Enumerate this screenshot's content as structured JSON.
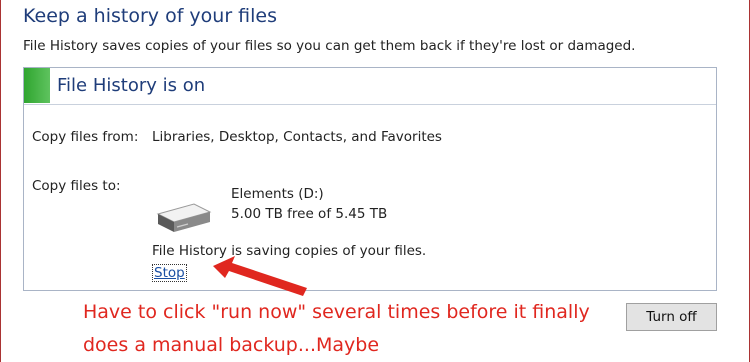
{
  "page": {
    "title": "Keep a history of your files",
    "description": "File History saves copies of your files so you can get them back if they're lost or damaged."
  },
  "status_panel": {
    "status_title": "File History is on",
    "status_color": "#3bab3b",
    "copy_from_label": "Copy files from:",
    "copy_from_value": "Libraries, Desktop, Contacts, and Favorites",
    "copy_to_label": "Copy files to:",
    "drive_icon": "hard-drive-icon",
    "drive_name": "Elements (D:)",
    "drive_space": "5.00 TB free of 5.45 TB",
    "saving_message": "File History is saving copies of your files.",
    "stop_link": "Stop"
  },
  "annotation": {
    "text": "Have to click \"run now\" several times before it finally does a manual backup...Maybe",
    "color": "#e0271f",
    "arrow_icon": "red-arrow-icon"
  },
  "actions": {
    "turn_off_label": "Turn off"
  }
}
